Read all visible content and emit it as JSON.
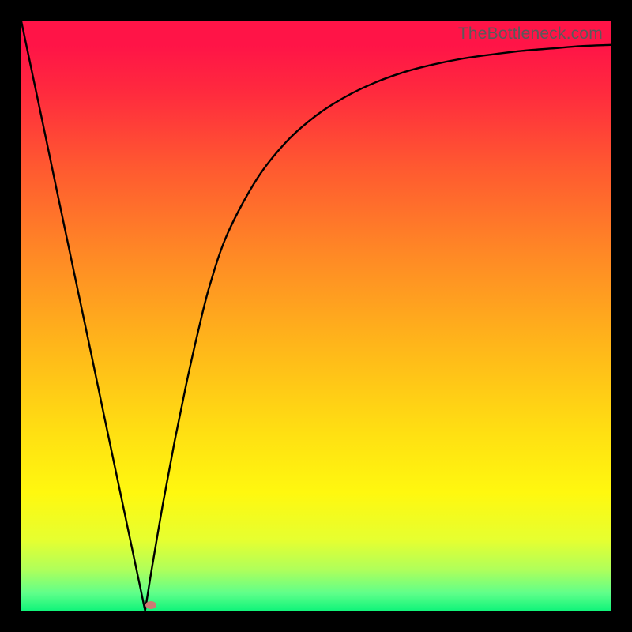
{
  "watermark": "TheBottleneck.com",
  "colors": {
    "gradient_top": "#ff1447",
    "gradient_mid_upper": "#ff8a25",
    "gradient_mid_lower": "#ffe012",
    "gradient_bottom": "#10f47a",
    "curve": "#000000",
    "frame": "#000000",
    "marker": "#cd7a74"
  },
  "chart_data": {
    "type": "line",
    "title": "",
    "xlabel": "",
    "ylabel": "",
    "xlim": [
      0,
      100
    ],
    "ylim": [
      0,
      100
    ],
    "x": [
      0,
      2,
      4,
      6,
      8,
      10,
      12,
      14,
      16,
      18,
      20,
      21,
      22,
      24,
      26,
      28,
      30,
      32,
      35,
      40,
      45,
      50,
      55,
      60,
      65,
      70,
      75,
      80,
      85,
      90,
      95,
      100
    ],
    "y": [
      100,
      90.5,
      81,
      71.4,
      61.9,
      52.4,
      42.9,
      33.3,
      23.8,
      14.3,
      4.8,
      0,
      6.3,
      18,
      28.7,
      38.5,
      47.4,
      55.3,
      64,
      73.3,
      79.6,
      84,
      87.2,
      89.6,
      91.4,
      92.7,
      93.7,
      94.4,
      95,
      95.4,
      95.8,
      96
    ],
    "marker": {
      "x": 22,
      "y": 1
    },
    "annotations": []
  }
}
